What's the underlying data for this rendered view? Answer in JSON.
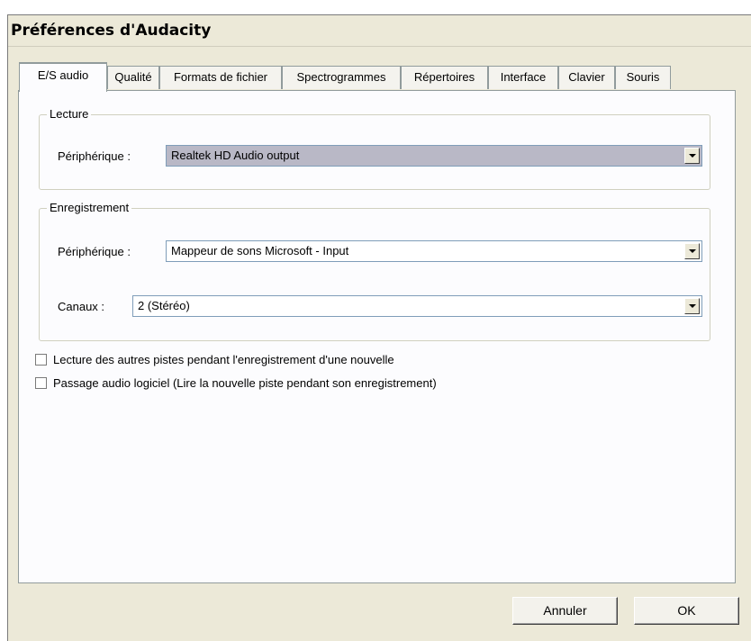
{
  "window": {
    "title": "Préférences d'Audacity"
  },
  "tabs": [
    {
      "label": "E/S audio"
    },
    {
      "label": "Qualité"
    },
    {
      "label": "Formats de fichier"
    },
    {
      "label": "Spectrogrammes"
    },
    {
      "label": "Répertoires"
    },
    {
      "label": "Interface"
    },
    {
      "label": "Clavier"
    },
    {
      "label": "Souris"
    }
  ],
  "playback": {
    "legend": "Lecture",
    "device_label": "Périphérique :",
    "device_value": "Realtek HD Audio output"
  },
  "recording": {
    "legend": "Enregistrement",
    "device_label": "Périphérique :",
    "device_value": "Mappeur de sons Microsoft - Input",
    "channels_label": "Canaux :",
    "channels_value": "2 (Stéréo)"
  },
  "options": {
    "overdub": {
      "label": "Lecture des autres pistes pendant l'enregistrement d'une nouvelle",
      "checked": false
    },
    "playthrough": {
      "label": "Passage audio logiciel (Lire la nouvelle piste pendant son enregistrement)",
      "checked": false
    }
  },
  "buttons": {
    "cancel": "Annuler",
    "ok": "OK"
  }
}
